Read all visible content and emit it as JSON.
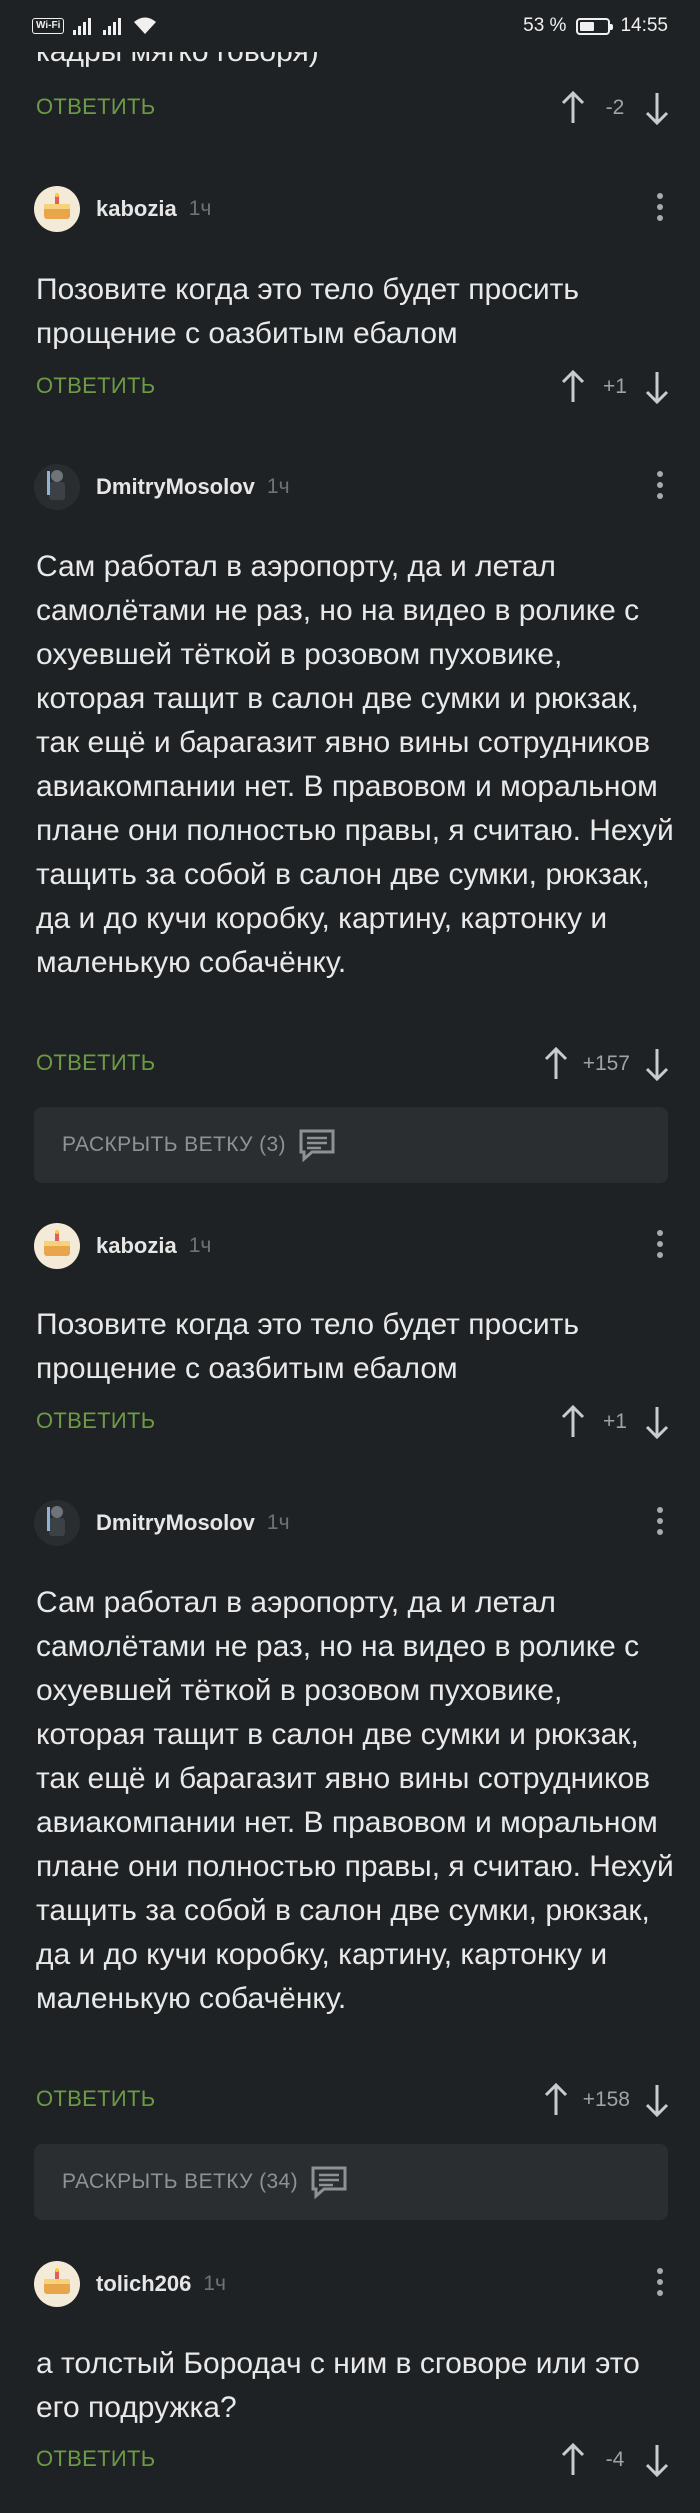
{
  "status_bar": {
    "battery": "53 %",
    "time": "14:55",
    "wifi_label": "Wi-Fi",
    "battery_level": 0.53,
    "icons": [
      "signal-icon",
      "signal-icon",
      "wifi-icon",
      "battery-icon"
    ]
  },
  "partial": {
    "text": "кадры мягко говоря)",
    "reply_label": "ОТВЕТИТЬ",
    "score": "-2"
  },
  "comments": [
    {
      "username": "kabozia",
      "time": "1ч",
      "avatar": "cake-avatar",
      "text": "Позовите когда это тело будет просить прощение с оазбитым ебалом",
      "reply_label": "ОТВЕТИТЬ",
      "score": "+1"
    },
    {
      "username": "DmitryMosolov",
      "time": "1ч",
      "avatar": "figure-avatar",
      "text": "Сам работал в аэропорту, да и летал самолётами не раз, но на видео в ролике с охуевшей тёткой в розовом пуховике, которая тащит в салон две сумки и рюкзак, так ещё и барагазит явно вины сотрудников авиакомпании нет. В правовом и моральном плане они полностью правы, я считаю. Нехуй тащить за собой в салон две сумки, рюкзак, да и до кучи коробку, картину, картонку и маленькую собачёнку.",
      "reply_label": "ОТВЕТИТЬ",
      "score": "+157",
      "thread_label": "РАСКРЫТЬ ВЕТКУ (3)"
    },
    {
      "username": "kabozia",
      "time": "1ч",
      "avatar": "cake-avatar",
      "text": "Позовите когда это тело будет просить прощение с оазбитым ебалом",
      "reply_label": "ОТВЕТИТЬ",
      "score": "+1"
    },
    {
      "username": "DmitryMosolov",
      "time": "1ч",
      "avatar": "figure-avatar",
      "text": "Сам работал в аэропорту, да и летал самолётами не раз, но на видео в ролике с охуевшей тёткой в розовом пуховике, которая тащит в салон две сумки и рюкзак, так ещё и барагазит явно вины сотрудников авиакомпании нет. В правовом и моральном плане они полностью правы, я считаю. Нехуй тащить за собой в салон две сумки, рюкзак, да и до кучи коробку, картину, картонку и маленькую собачёнку.",
      "reply_label": "ОТВЕТИТЬ",
      "score": "+158",
      "thread_label": "РАСКРЫТЬ ВЕТКУ (34)"
    },
    {
      "username": "tolich206",
      "time": "1ч",
      "avatar": "cake-avatar",
      "text": "а толстый Бородач с ним в сговоре или это его подружка?",
      "reply_label": "ОТВЕТИТЬ",
      "score": "-4"
    }
  ]
}
